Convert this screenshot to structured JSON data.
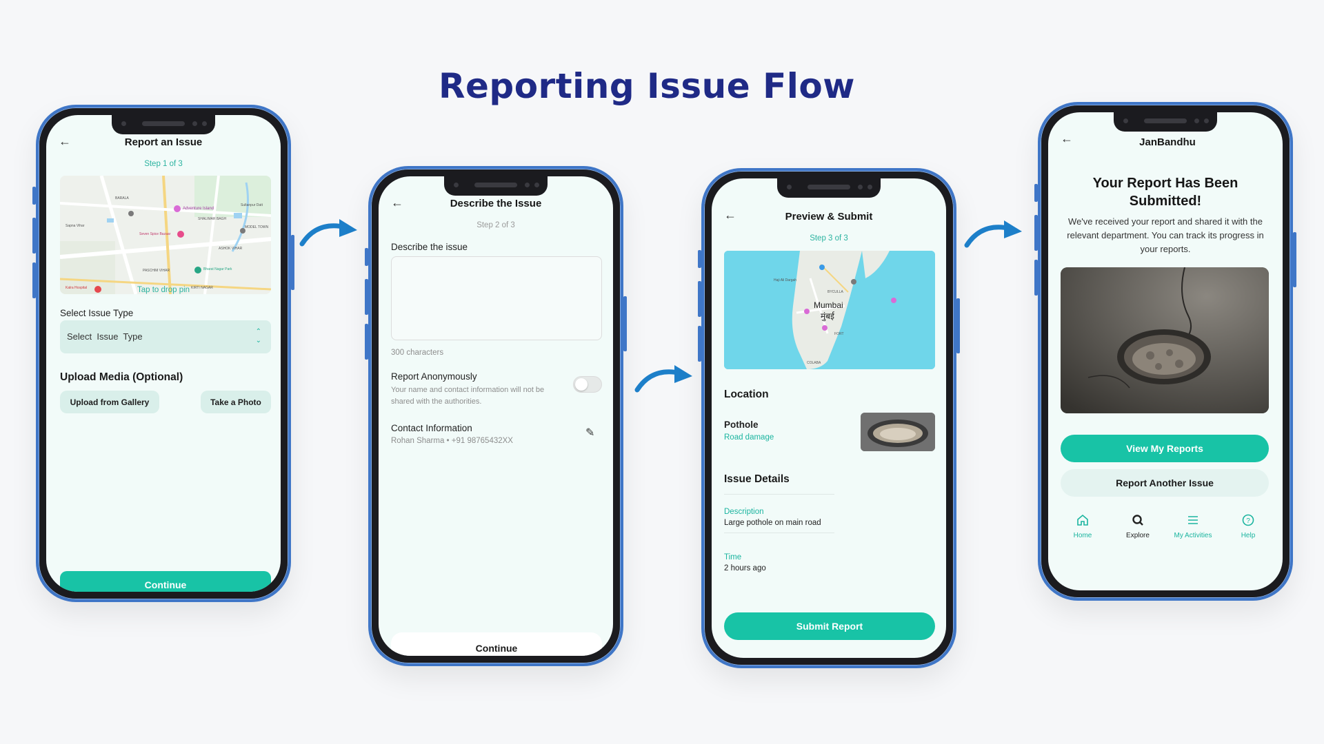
{
  "title": "Reporting Issue Flow",
  "screen1": {
    "header": "Report an Issue",
    "step": "Step 1 of 3",
    "map_labels": [
      "BARALA",
      "Adventure Island",
      "SHALIMAR BAGH",
      "Sultanpur Datt",
      "MODEL TOWN",
      "Sapna Vihar",
      "Seven Spice Bazaar",
      "PASCHIM VIHAR",
      "ASHOK VIHAR",
      "Bharat Nagar Park",
      "KIRTI NAGAR",
      "Kalra Hospital"
    ],
    "tap_hint": "Tap to drop pin",
    "issue_type_label": "Select Issue Type",
    "issue_type_value": "Select  Issue  Type",
    "upload_heading": "Upload Media (Optional)",
    "gallery_button": "Upload from Gallery",
    "photo_button": "Take a Photo",
    "continue_button": "Continue"
  },
  "screen2": {
    "header": "Describe the Issue",
    "step": "Step 2 of 3",
    "describe_label": "Describe the issue",
    "textarea_value": "",
    "char_count": "300 characters",
    "anon_title": "Report Anonymously",
    "anon_desc": "Your name and contact information will not be shared with the authorities.",
    "contact_title": "Contact Information",
    "contact_value": "Rohan Sharma • +91 98765432XX",
    "continue_button": "Continue"
  },
  "screen3": {
    "header": "Preview & Submit",
    "step": "Step 3 of 3",
    "map_city": "Mumbai",
    "map_city_local": "मुंबई",
    "map_labels": [
      "BYCULLA",
      "Haji Ali Dargah",
      "COLABA",
      "FORT"
    ],
    "location_heading": "Location",
    "issue_title": "Pothole",
    "issue_category": "Road damage",
    "details_heading": "Issue Details",
    "description_label": "Description",
    "description_value": "Large pothole on main road",
    "time_label": "Time",
    "time_value": "2 hours ago",
    "submit_button": "Submit Report"
  },
  "screen4": {
    "header": "JanBandhu",
    "title": "Your Report Has Been Submitted!",
    "message": "We've received your report and shared it with the relevant department. You can track its progress in your reports.",
    "view_button": "View My Reports",
    "another_button": "Report Another Issue",
    "nav": [
      {
        "label": "Home",
        "icon": "home-icon",
        "color": "#1ab49f"
      },
      {
        "label": "Explore",
        "icon": "search-icon",
        "color": "#222222"
      },
      {
        "label": "My Activities",
        "icon": "list-icon",
        "color": "#1ab49f"
      },
      {
        "label": "Help",
        "icon": "help-icon",
        "color": "#1ab49f"
      }
    ]
  },
  "colors": {
    "accent": "#18c3a6",
    "title": "#1f2a86",
    "phone_frame": "#3f76c7",
    "arrow": "#1d7fc9"
  }
}
